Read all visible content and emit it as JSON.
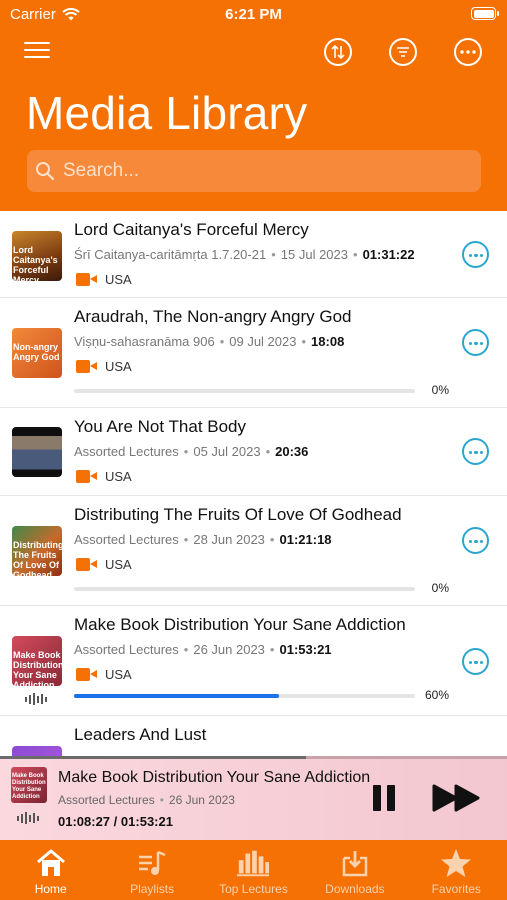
{
  "status_bar": {
    "carrier": "Carrier",
    "time": "6:21 PM"
  },
  "header": {
    "title": "Media Library",
    "search_placeholder": "Search...",
    "icons": [
      "menu-icon",
      "sort-icon",
      "filter-icon",
      "more-icon"
    ]
  },
  "lectures": [
    {
      "title": "Lord Caitanya's Forceful Mercy",
      "source": "Śrī Caitanya-caritāmṛta 1.7.20-21",
      "date": "15 Jul 2023",
      "duration": "01:31:22",
      "location": "USA",
      "thumb_text": "Lord Caitanya's Forceful Mercy"
    },
    {
      "title": "Araudrah, The Non-angry Angry God",
      "source": "Viṣṇu-sahasranāma 906",
      "date": "09 Jul 2023",
      "duration": "18:08",
      "location": "USA",
      "progress": 0,
      "progress_label": "0%",
      "thumb_text": "Non-angry Angry God"
    },
    {
      "title": "You Are Not That Body",
      "source": "Assorted Lectures",
      "date": "05 Jul 2023",
      "duration": "20:36",
      "location": "USA"
    },
    {
      "title": "Distributing The Fruits Of Love Of Godhead",
      "source": "Assorted Lectures",
      "date": "28 Jun 2023",
      "duration": "01:21:18",
      "location": "USA",
      "progress": 0,
      "progress_label": "0%",
      "thumb_text": "Distributing The Fruits Of Love Of Godhead"
    },
    {
      "title": "Make Book Distribution Your Sane Addiction",
      "source": "Assorted Lectures",
      "date": "26 Jun 2023",
      "duration": "01:53:21",
      "location": "USA",
      "progress": 60,
      "progress_label": "60%",
      "thumb_text": "Make Book Distribution Your Sane Addiction",
      "playing": true
    },
    {
      "title": "Leaders And Lust"
    }
  ],
  "now_playing": {
    "title": "Make Book Distribution Your Sane Addiction",
    "source": "Assorted Lectures",
    "date": "26 Jun 2023",
    "elapsed": "01:08:27",
    "separator": "/",
    "total": "01:53:21",
    "thumb_text": "Make Book Distribution Your Sane Addiction",
    "progress": 60
  },
  "tabs": [
    {
      "label": "Home",
      "icon": "home-icon",
      "active": true
    },
    {
      "label": "Playlists",
      "icon": "playlist-icon",
      "active": false
    },
    {
      "label": "Top Lectures",
      "icon": "bar-chart-icon",
      "active": false
    },
    {
      "label": "Downloads",
      "icon": "download-icon",
      "active": false
    },
    {
      "label": "Favorites",
      "icon": "star-icon",
      "active": false
    }
  ],
  "colors": {
    "accent": "#f57104",
    "link": "#2aa6cf",
    "progress": "#1a73e8",
    "player_bg": "#f8d3da"
  }
}
